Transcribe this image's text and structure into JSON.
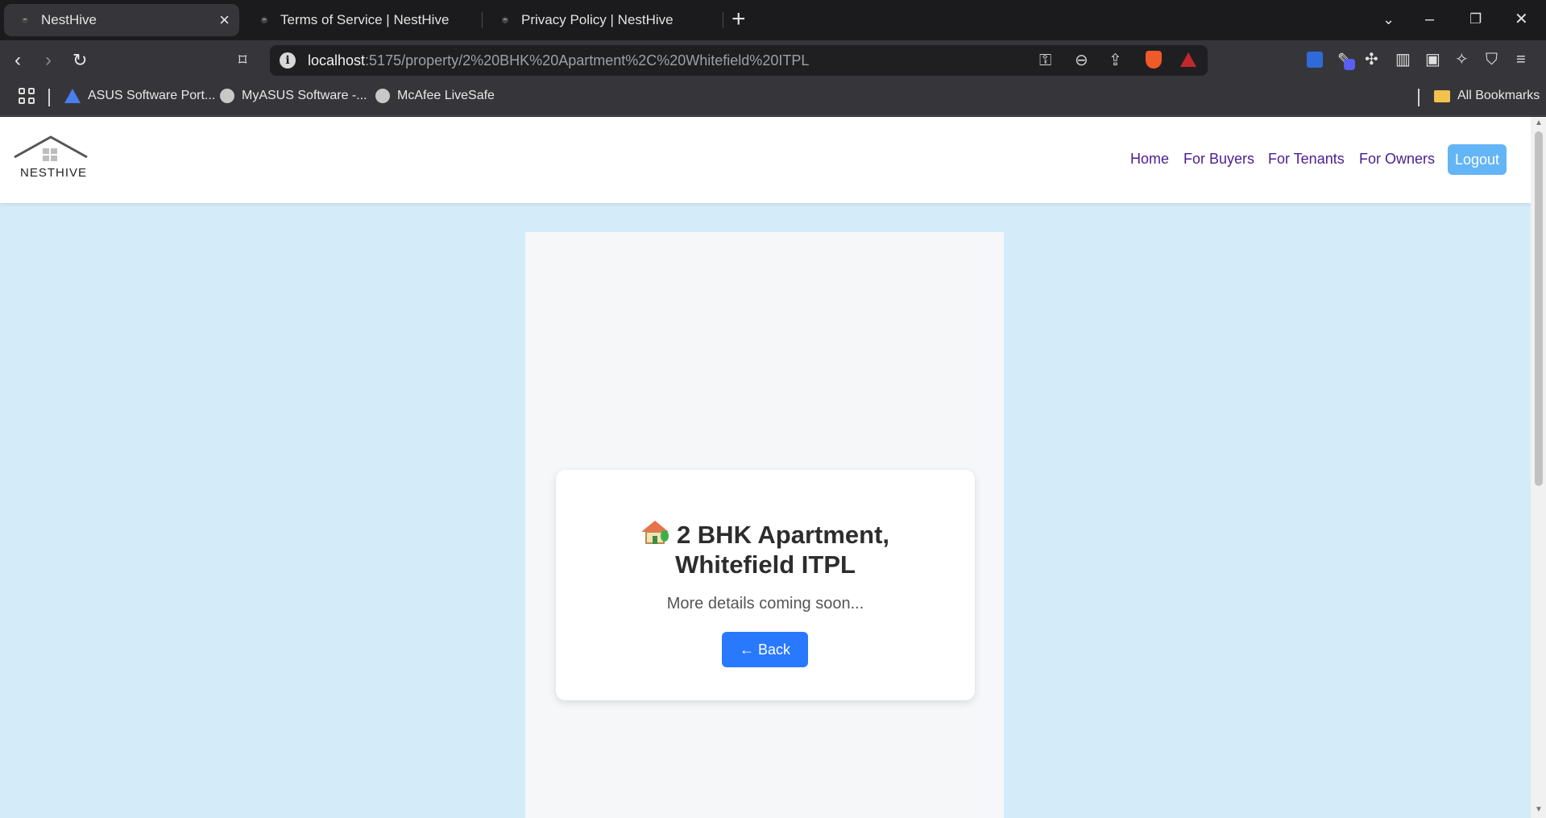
{
  "browser": {
    "tabs": [
      {
        "title": "NestHive",
        "active": true
      },
      {
        "title": "Terms of Service | NestHive",
        "active": false
      },
      {
        "title": "Privacy Policy | NestHive",
        "active": false
      }
    ],
    "url_host": "localhost",
    "url_rest": ":5175/property/2%20BHK%20Apartment%2C%20Whitefield%20ITPL",
    "bookmarks": [
      {
        "label": "ASUS Software Port...",
        "icon": "asus-icon"
      },
      {
        "label": "MyASUS Software -...",
        "icon": "globe-icon"
      },
      {
        "label": "McAfee LiveSafe",
        "icon": "globe-icon"
      }
    ],
    "all_bookmarks_label": "All Bookmarks"
  },
  "site": {
    "logo_text": "NESTHIVE",
    "nav": [
      "Home",
      "For Buyers",
      "For Tenants",
      "For Owners"
    ],
    "logout_label": "Logout"
  },
  "property": {
    "title_line1": "2 BHK Apartment,",
    "title_line2": "Whitefield ITPL",
    "subtitle": "More details coming soon...",
    "back_label": "← Back"
  },
  "colors": {
    "page_background": "#d4ebfa",
    "nav_link": "#4b1d8f",
    "logout_button": "#64b5f6",
    "back_button": "#2979ff"
  }
}
